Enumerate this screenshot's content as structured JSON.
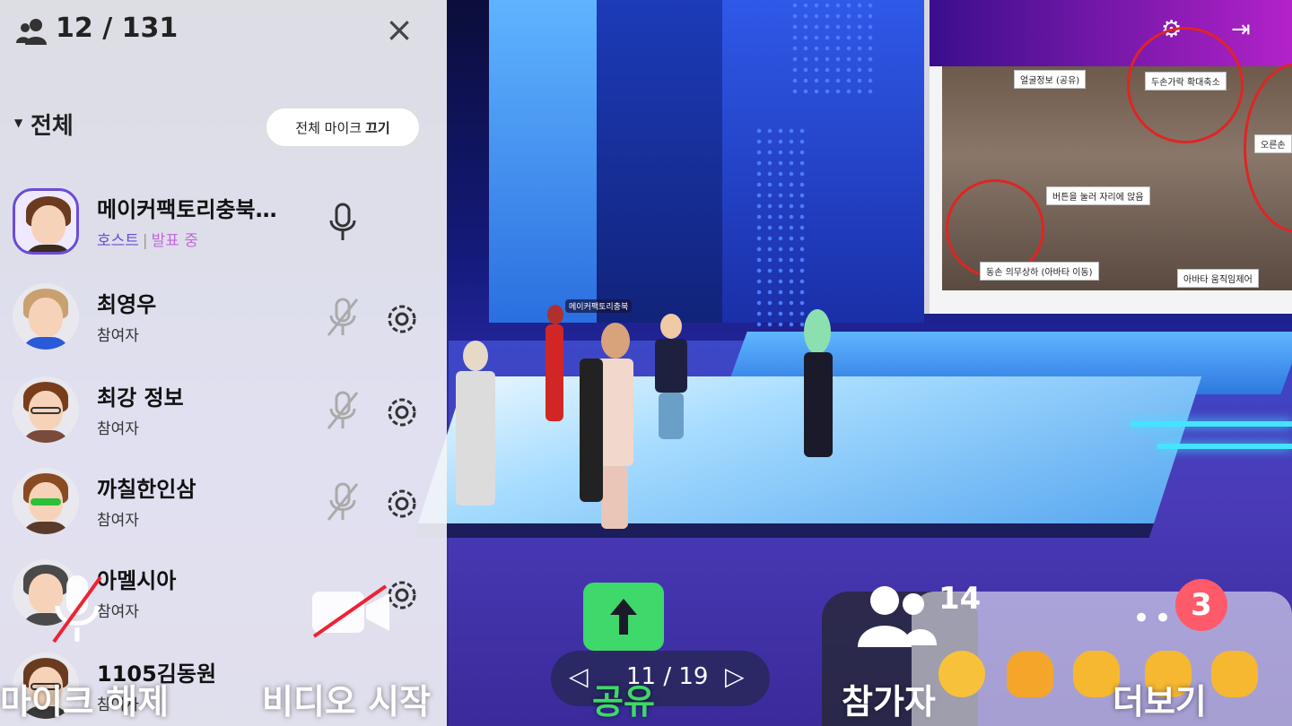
{
  "panel": {
    "count": "12 / 131",
    "section_title": "전체",
    "mute_all_prefix": "전체 마이크",
    "mute_all_action": "끄기",
    "participants": [
      {
        "name": "메이커팩토리충북…",
        "role": "호스트",
        "status": "발표 중",
        "mic": "on",
        "host": true
      },
      {
        "name": "최영우",
        "role": "참여자",
        "mic": "off"
      },
      {
        "name": "최강 정보",
        "role": "참여자",
        "mic": "off"
      },
      {
        "name": "까칠한인삼",
        "role": "참여자",
        "mic": "off"
      },
      {
        "name": "아멜시아",
        "role": "참여자",
        "mic": "off"
      },
      {
        "name": "1105김동원",
        "role": "참여자",
        "mic": "off"
      }
    ]
  },
  "toolbar": {
    "mic_label": "마이크 해제",
    "video_label": "비디오 시작",
    "share_label": "공유",
    "pager": "11 / 19",
    "participants_label": "참가자",
    "participants_count": "14",
    "more_label": "더보기",
    "notification_count": "3"
  },
  "scene": {
    "presenter_tag": "메이커팩토리충북",
    "screen_captions": [
      "두손가락 확대축소",
      "오른손",
      "버튼을 눌러 자리에 앉음",
      "동손 의무상하 (아바타 이동)",
      "아바타 움직임제어",
      "얼굴정보 (공유)"
    ]
  },
  "colors": {
    "accent": "#6a4cd6",
    "presenting": "#c06ad8",
    "share": "#3fd86a",
    "badge": "#ff5a6a"
  }
}
